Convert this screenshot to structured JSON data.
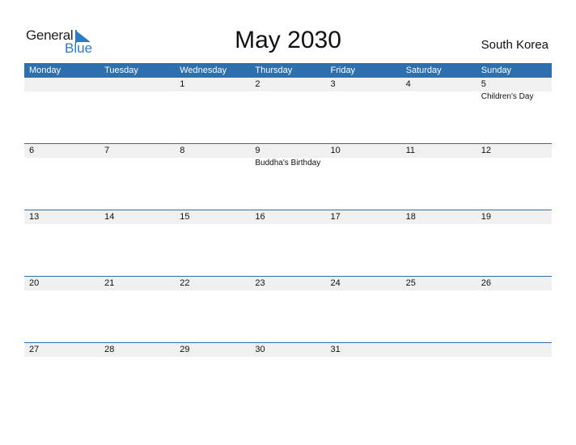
{
  "logo": {
    "word1": "General",
    "word2": "Blue"
  },
  "title": "May 2030",
  "country": "South Korea",
  "colors": {
    "accent": "#2e6fad",
    "strip": "#f0f0f0"
  },
  "weekdays": [
    "Monday",
    "Tuesday",
    "Wednesday",
    "Thursday",
    "Friday",
    "Saturday",
    "Sunday"
  ],
  "weeks": [
    [
      {
        "d": ""
      },
      {
        "d": ""
      },
      {
        "d": "1"
      },
      {
        "d": "2"
      },
      {
        "d": "3"
      },
      {
        "d": "4"
      },
      {
        "d": "5",
        "h": "Children's Day"
      }
    ],
    [
      {
        "d": "6"
      },
      {
        "d": "7"
      },
      {
        "d": "8"
      },
      {
        "d": "9",
        "h": "Buddha's Birthday"
      },
      {
        "d": "10"
      },
      {
        "d": "11"
      },
      {
        "d": "12"
      }
    ],
    [
      {
        "d": "13"
      },
      {
        "d": "14"
      },
      {
        "d": "15"
      },
      {
        "d": "16"
      },
      {
        "d": "17"
      },
      {
        "d": "18"
      },
      {
        "d": "19"
      }
    ],
    [
      {
        "d": "20"
      },
      {
        "d": "21"
      },
      {
        "d": "22"
      },
      {
        "d": "23"
      },
      {
        "d": "24"
      },
      {
        "d": "25"
      },
      {
        "d": "26"
      }
    ],
    [
      {
        "d": "27"
      },
      {
        "d": "28"
      },
      {
        "d": "29"
      },
      {
        "d": "30"
      },
      {
        "d": "31"
      },
      {
        "d": ""
      },
      {
        "d": ""
      }
    ]
  ]
}
